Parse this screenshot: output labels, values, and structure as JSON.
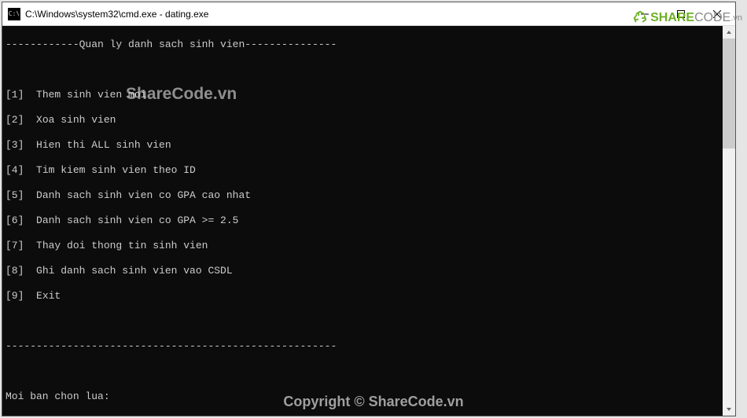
{
  "window": {
    "title": "C:\\Windows\\system32\\cmd.exe - dating.exe",
    "icon_label": "C:\\"
  },
  "console": {
    "header_line": "------------Quan ly danh sach sinh vien---------------",
    "menu": [
      {
        "key": "[1]",
        "label": "Them sinh vien moi"
      },
      {
        "key": "[2]",
        "label": "Xoa sinh vien"
      },
      {
        "key": "[3]",
        "label": "Hien thi ALL sinh vien"
      },
      {
        "key": "[4]",
        "label": "Tim kiem sinh vien theo ID"
      },
      {
        "key": "[5]",
        "label": "Danh sach sinh vien co GPA cao nhat"
      },
      {
        "key": "[6]",
        "label": "Danh sach sinh vien co GPA >= 2.5"
      },
      {
        "key": "[7]",
        "label": "Thay doi thong tin sinh vien"
      },
      {
        "key": "[8]",
        "label": "Ghi danh sach sinh vien vao CSDL"
      },
      {
        "key": "[9]",
        "label": "Exit"
      }
    ],
    "divider": "------------------------------------------------------",
    "prompt": "Moi ban chon lua:"
  },
  "watermark": {
    "center": "ShareCode.vn",
    "bottom": "Copyright © ShareCode.vn",
    "logo_green": "SHARE",
    "logo_gray": "CODE",
    "logo_vn": ".vn"
  }
}
